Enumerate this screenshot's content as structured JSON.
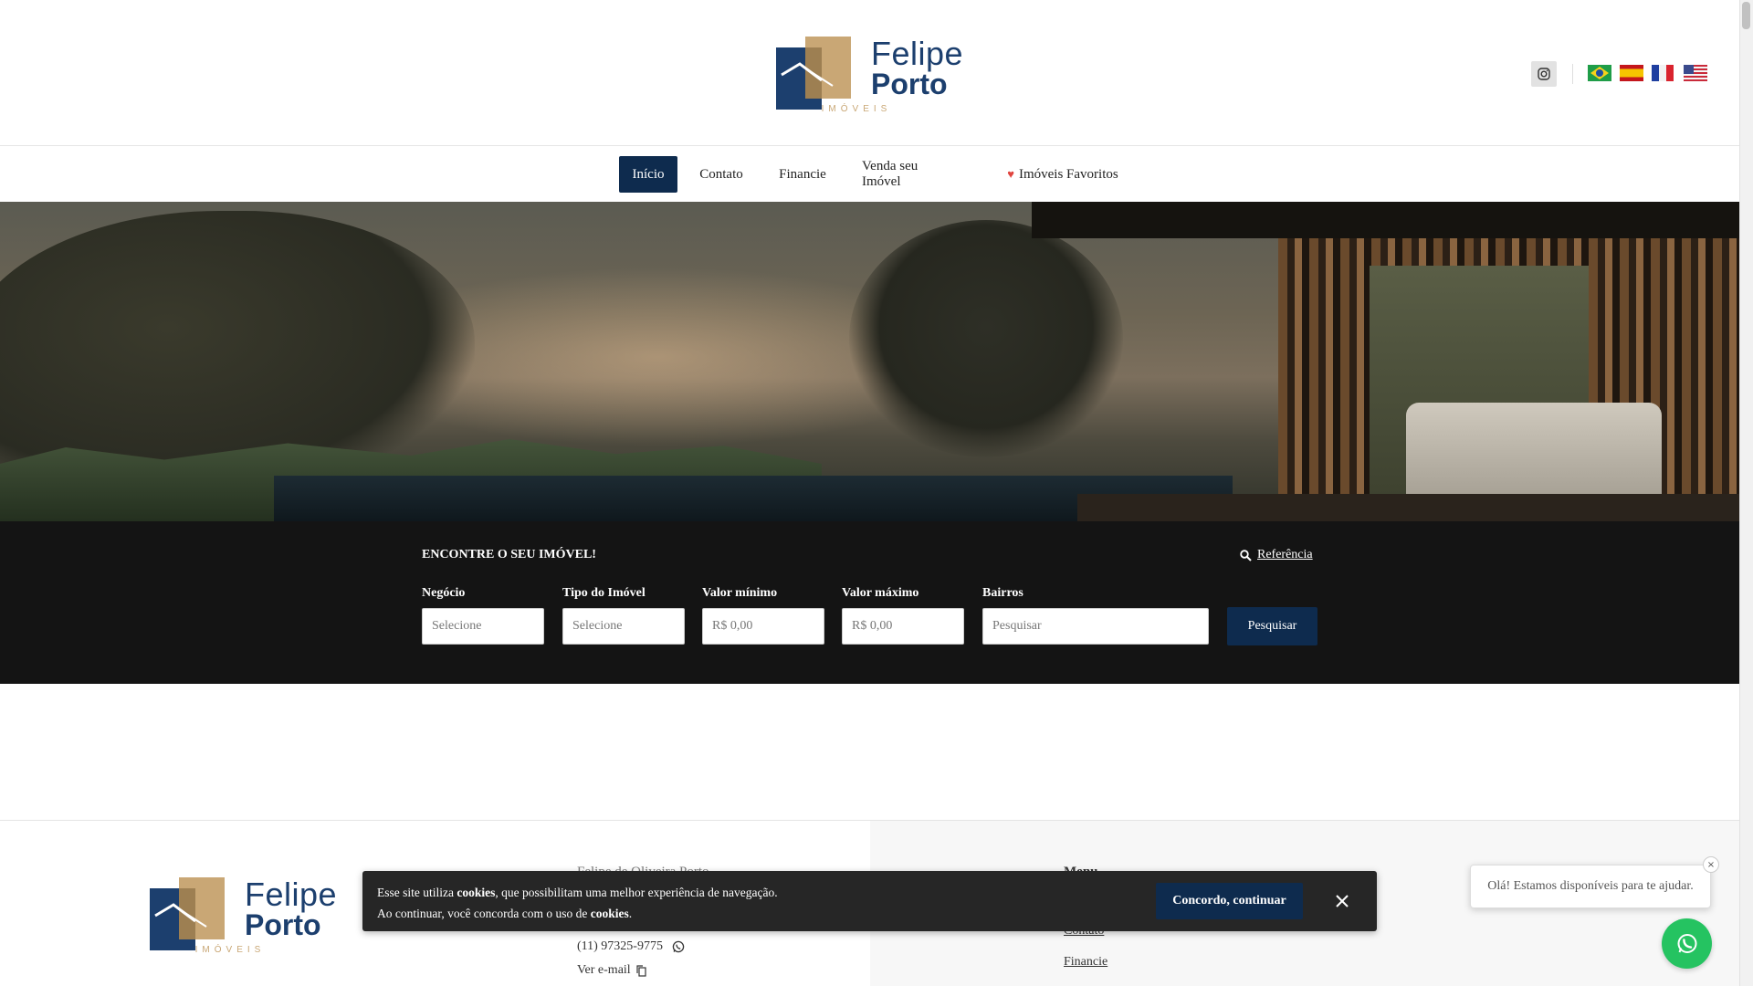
{
  "brand": {
    "name_line1": "Felipe",
    "name_line2": "Porto",
    "tagline": "IMÓVEIS",
    "colors": {
      "navy": "#1c3f6e",
      "gold": "#c9a775"
    }
  },
  "header": {
    "social": [
      {
        "icon": "instagram-icon"
      }
    ],
    "languages": [
      {
        "icon": "brazil-flag-icon"
      },
      {
        "icon": "spain-flag-icon"
      },
      {
        "icon": "france-flag-icon"
      },
      {
        "icon": "usa-flag-icon"
      }
    ]
  },
  "nav": {
    "items": [
      {
        "label": "Início",
        "active": true
      },
      {
        "label": "Contato"
      },
      {
        "label": "Financie"
      },
      {
        "label": "Venda seu Imóvel"
      },
      {
        "label": "Imóveis Favoritos",
        "icon": "heart-icon"
      }
    ]
  },
  "search": {
    "title": "ENCONTRE O SEU IMÓVEL!",
    "reference_link": "Referência",
    "fields": [
      {
        "label": "Negócio",
        "placeholder": "Selecione"
      },
      {
        "label": "Tipo do Imóvel",
        "placeholder": "Selecione"
      },
      {
        "label": "Valor mínimo",
        "placeholder": "R$ 0,00"
      },
      {
        "label": "Valor máximo",
        "placeholder": "R$ 0,00"
      },
      {
        "label": "Bairros",
        "placeholder": "Pesquisar"
      }
    ],
    "button": "Pesquisar"
  },
  "footer": {
    "name": "Felipe de Oliveira Porto",
    "phone": "(11) 97325-9775",
    "email_link": "Ver e-mail",
    "menu_heading": "Menu",
    "menu_links": [
      "Contato",
      "Financie"
    ]
  },
  "cookie": {
    "line1_a": "Esse site utiliza ",
    "line1_b": "cookies",
    "line1_c": ", que possibilitam uma melhor experiência de navegação.",
    "line2_a": "Ao continuar, você concorda com o uso de ",
    "line2_b": "cookies",
    "line2_c": ".",
    "accept": "Concordo, continuar"
  },
  "whatsapp": {
    "bubble": "Olá! Estamos disponíveis para te ajudar.",
    "close": "×",
    "color": "#25c361"
  }
}
